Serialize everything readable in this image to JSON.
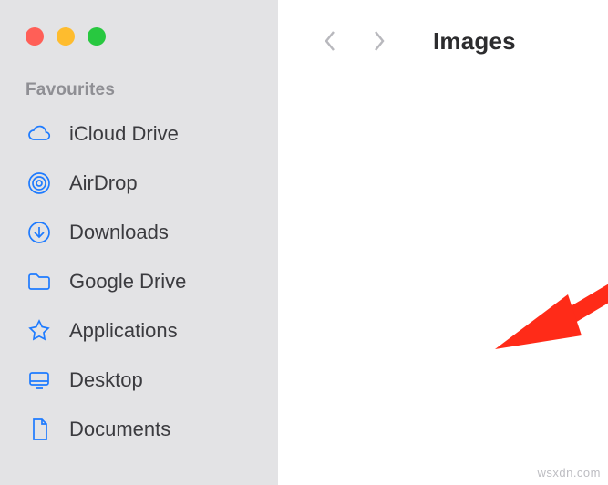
{
  "window": {
    "traffic_colors": {
      "close": "#ff5f57",
      "min": "#febc2e",
      "max": "#28c840"
    }
  },
  "sidebar": {
    "section_title": "Favourites",
    "items": [
      {
        "label": "iCloud Drive",
        "icon": "cloud-icon"
      },
      {
        "label": "AirDrop",
        "icon": "airdrop-icon"
      },
      {
        "label": "Downloads",
        "icon": "download-icon"
      },
      {
        "label": "Google Drive",
        "icon": "folder-icon"
      },
      {
        "label": "Applications",
        "icon": "applications-icon"
      },
      {
        "label": "Desktop",
        "icon": "desktop-icon"
      },
      {
        "label": "Documents",
        "icon": "document-icon"
      }
    ]
  },
  "toolbar": {
    "title": "Images"
  },
  "annotation": {
    "arrow_color": "#ff2b18",
    "target_item_index": 4
  },
  "watermark": "wsxdn.com",
  "colors": {
    "accent": "#1e7bff",
    "sidebar_bg": "#e3e3e5",
    "text": "#3b3b3f",
    "muted": "#8f8f94"
  }
}
